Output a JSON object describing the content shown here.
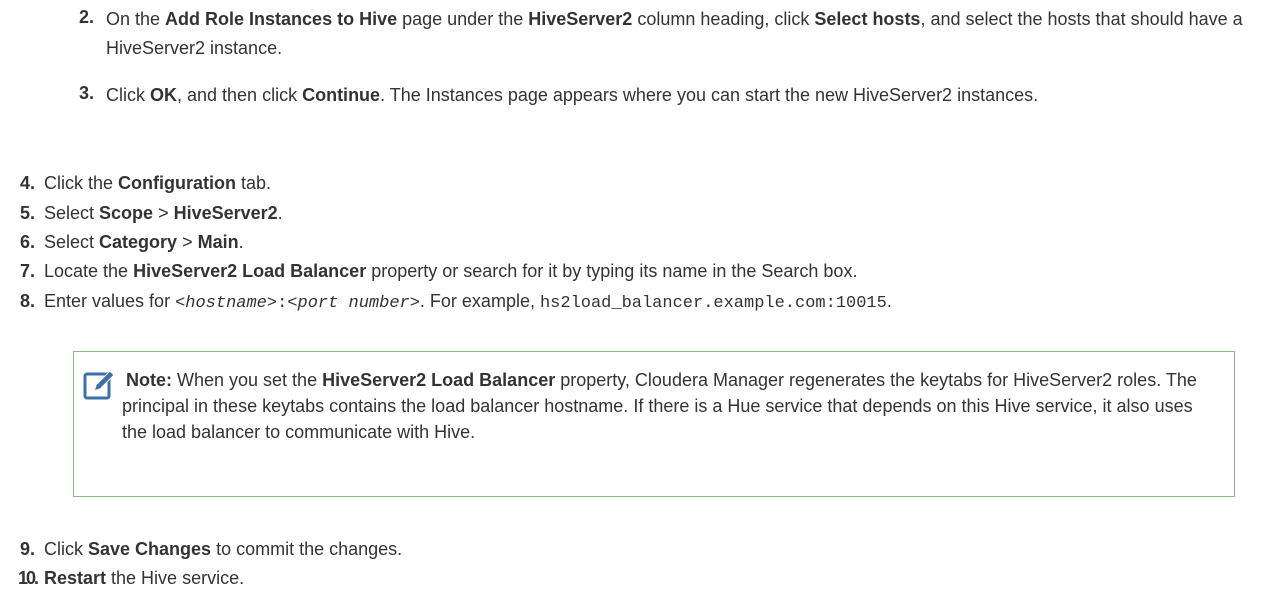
{
  "steps": [
    {
      "num": "2.",
      "parts": [
        "On the ",
        "Add Role Instances to Hive",
        " page under the ",
        "HiveServer2",
        " column heading, click ",
        "Select hosts",
        ", and select the hosts that should have a HiveServer2 instance."
      ]
    },
    {
      "num": "3.",
      "parts": [
        "Click ",
        "OK",
        ", and then click ",
        "Continue",
        ". The Instances page appears where you can start the new HiveServer2 instances."
      ]
    },
    {
      "num": "4.",
      "parts": [
        "Click the ",
        "Configuration",
        " tab."
      ]
    },
    {
      "num": "5.",
      "parts": [
        "Select ",
        "Scope",
        " > ",
        "HiveServer2",
        "."
      ]
    },
    {
      "num": "6.",
      "parts": [
        "Select ",
        "Category",
        " > ",
        "Main",
        "."
      ]
    },
    {
      "num": "7.",
      "parts": [
        "Locate the ",
        "HiveServer2 Load Balancer",
        " property or search for it by typing its name in the Search box."
      ]
    },
    {
      "num": "8.",
      "parts": [
        "Enter values for ",
        "<",
        "hostname",
        ">:<",
        "port number",
        ">",
        ". For example, ",
        "hs2load_balancer.example.com:10015",
        "."
      ]
    },
    {
      "num": "9.",
      "parts": [
        "Click ",
        "Save Changes",
        " to commit the changes."
      ]
    },
    {
      "num": "10.",
      "parts": [
        "Restart",
        " the Hive service."
      ]
    }
  ],
  "note": {
    "label": "Note:",
    "parts": [
      " When you set the ",
      "HiveServer2 Load Balancer",
      " property, Cloudera Manager regenerates the keytabs for HiveServer2 roles. The principal in these keytabs contains the load balancer hostname. If there is a Hue service that depends on this Hive service, it also uses the load balancer to communicate with Hive."
    ],
    "icon": "note-edit-icon",
    "border_color": "#8cb87e",
    "icon_color": "#3d6fa8"
  }
}
